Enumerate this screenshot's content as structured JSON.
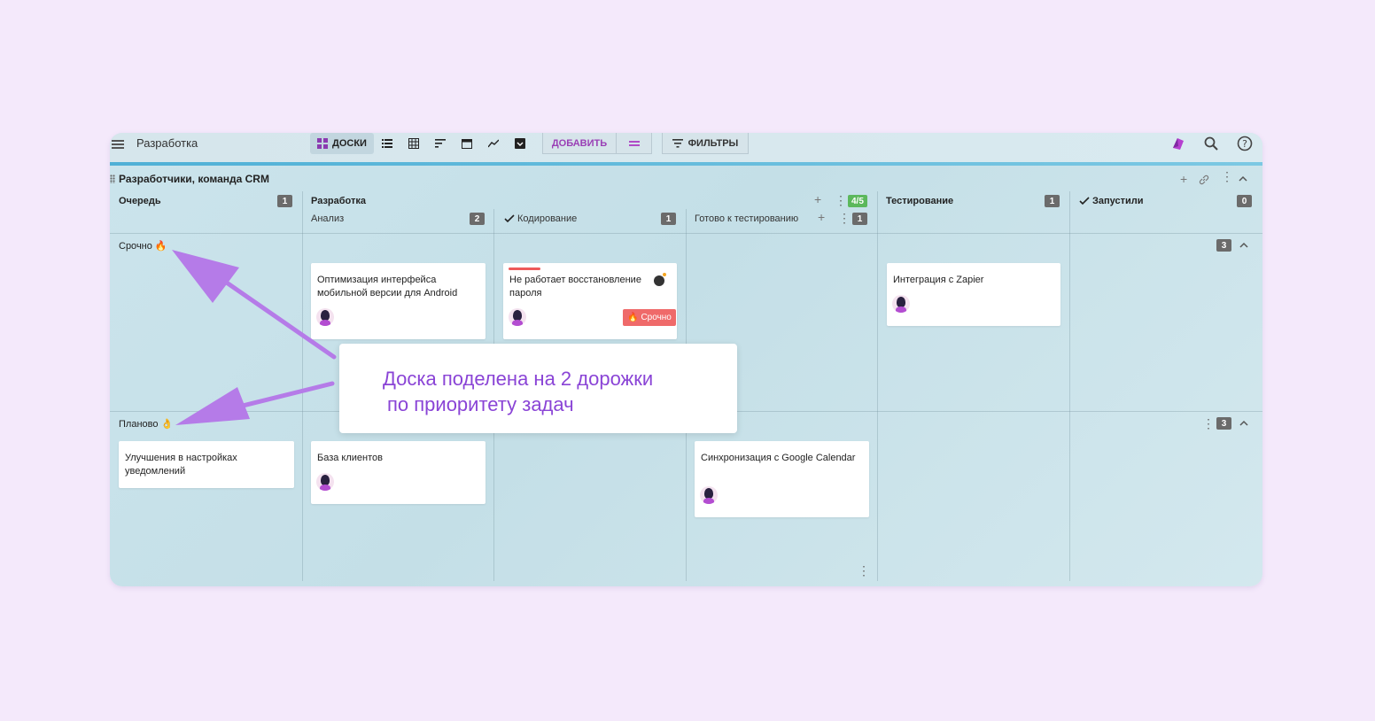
{
  "app": {
    "title": "Разработка",
    "views": {
      "boards_label": "ДОСКИ",
      "icons": [
        "list-icon",
        "table-icon",
        "gantt-icon",
        "calendar-icon",
        "chart-icon",
        "archive-icon"
      ]
    },
    "add_label": "ДОБАВИТЬ",
    "filters_label": "ФИЛЬТРЫ",
    "accent": "#9a3fb5"
  },
  "board": {
    "title": "Разработчики, команда CRM",
    "columns": [
      {
        "title": "Очередь",
        "count": "1"
      },
      {
        "title": "Разработка",
        "subcolumns": [
          {
            "title": "Анализ",
            "count": "2"
          },
          {
            "title": "Кодирование",
            "count": "1",
            "checked": true
          },
          {
            "title": "Готово к тестированию",
            "count": "1"
          }
        ],
        "wip": "4/5"
      },
      {
        "title": "Тестирование",
        "count": "1"
      },
      {
        "title": "Запустили",
        "count": "0",
        "checked": true
      }
    ],
    "lanes": [
      {
        "title": "Срочно",
        "emoji": "🔥",
        "count": "3",
        "cards": [
          {
            "text": "Оптимизация интерфейса мобильной версии для Android"
          },
          {
            "text": "Не работает восстановление пароля",
            "tag": "Срочно"
          },
          {
            "text": "Интеграция с Zapier"
          }
        ]
      },
      {
        "title": "Планово",
        "emoji": "👌",
        "count": "3",
        "cards": [
          {
            "text": "Улучшения в настройках уведомлений"
          },
          {
            "text": "База клиентов"
          },
          {
            "text": "Синхронизация с Google Calendar"
          }
        ]
      }
    ]
  },
  "callout": {
    "line1": "Доска поделена на 2 дорожки",
    "line2": "по приоритету задач"
  }
}
